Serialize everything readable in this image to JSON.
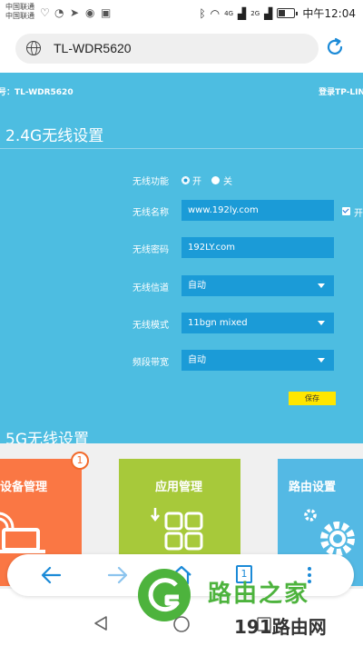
{
  "status_bar": {
    "carrier_line1": "中国联通",
    "carrier_line2": "中国联通",
    "signal_1_label": "4G",
    "signal_2_label": "2G",
    "time": "中午12:04"
  },
  "browser": {
    "url": "TL-WDR5620"
  },
  "router_page": {
    "model_label": "号：TL-WDR5620",
    "login_label": "登录TP-LIN",
    "section_24g": {
      "title": "2.4G无线设置",
      "wireless_function_label": "无线功能",
      "wireless_on_label": "开",
      "wireless_off_label": "关",
      "ssid_label": "无线名称",
      "ssid_value": "www.192ly.com",
      "ssid_broadcast_label": "开",
      "password_label": "无线密码",
      "password_value": "192LY.com",
      "channel_label": "无线信道",
      "channel_value": "自动",
      "mode_label": "无线模式",
      "mode_value": "11bgn mixed",
      "bandwidth_label": "频段带宽",
      "bandwidth_value": "自动",
      "save_label": "保存"
    },
    "section_5g": {
      "title": "5G无线设置"
    }
  },
  "tiles": [
    {
      "label": "设备管理",
      "badge": "1",
      "color": "#fa7744"
    },
    {
      "label": "应用管理",
      "color": "#a7c93a"
    },
    {
      "label": "路由设置",
      "color": "#54b9e4"
    }
  ],
  "browser_nav": {
    "tab_count": "1"
  },
  "watermark": {
    "brand": "路由之家",
    "site": "191路由网"
  },
  "colors": {
    "router_bg": "#4dbde1",
    "input_bg": "#1b9bd7",
    "save_button": "#ffe600",
    "accent_blue": "#1b8ad7"
  }
}
